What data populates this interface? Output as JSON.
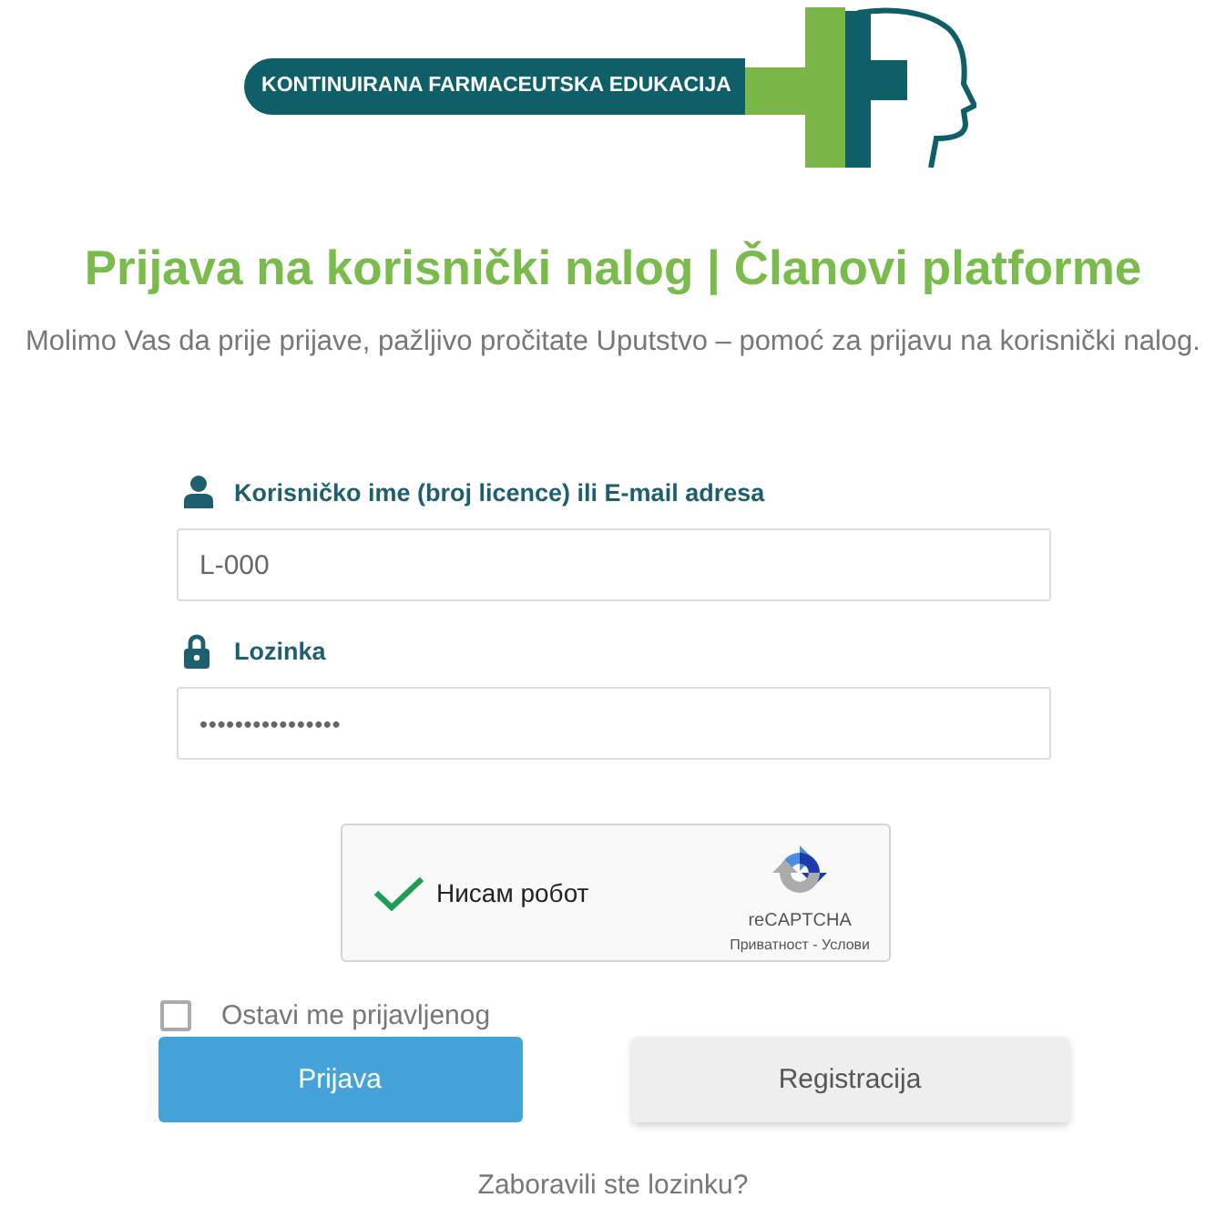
{
  "logo": {
    "text": "KONTINUIRANA FARMACEUTSKA EDUKACIJA"
  },
  "heading": "Prijava na korisnički nalog | Članovi platforme",
  "intro": "Molimo Vas da prije prijave, pažljivo pročitate Uputstvo – pomoć za prijavu na korisnički nalog.",
  "fields": [
    {
      "kind": "user",
      "label": "Korisničko ime (broj licence) ili E-mail adresa",
      "value": "L-000"
    },
    {
      "kind": "password",
      "label": "Lozinka",
      "value": "••••••••••••••••"
    }
  ],
  "captcha": {
    "checked": true,
    "label": "Нисам робот",
    "brand": "reCAPTCHA",
    "links": "Приватност - Услови"
  },
  "remember": {
    "checked": false,
    "label": "Ostavi me prijavljenog"
  },
  "buttons": [
    {
      "kind": "primary",
      "label": "Prijava"
    },
    {
      "kind": "secondary",
      "label": "Registracija"
    }
  ],
  "forgot_link": "Zaboravili ste lozinku?"
}
